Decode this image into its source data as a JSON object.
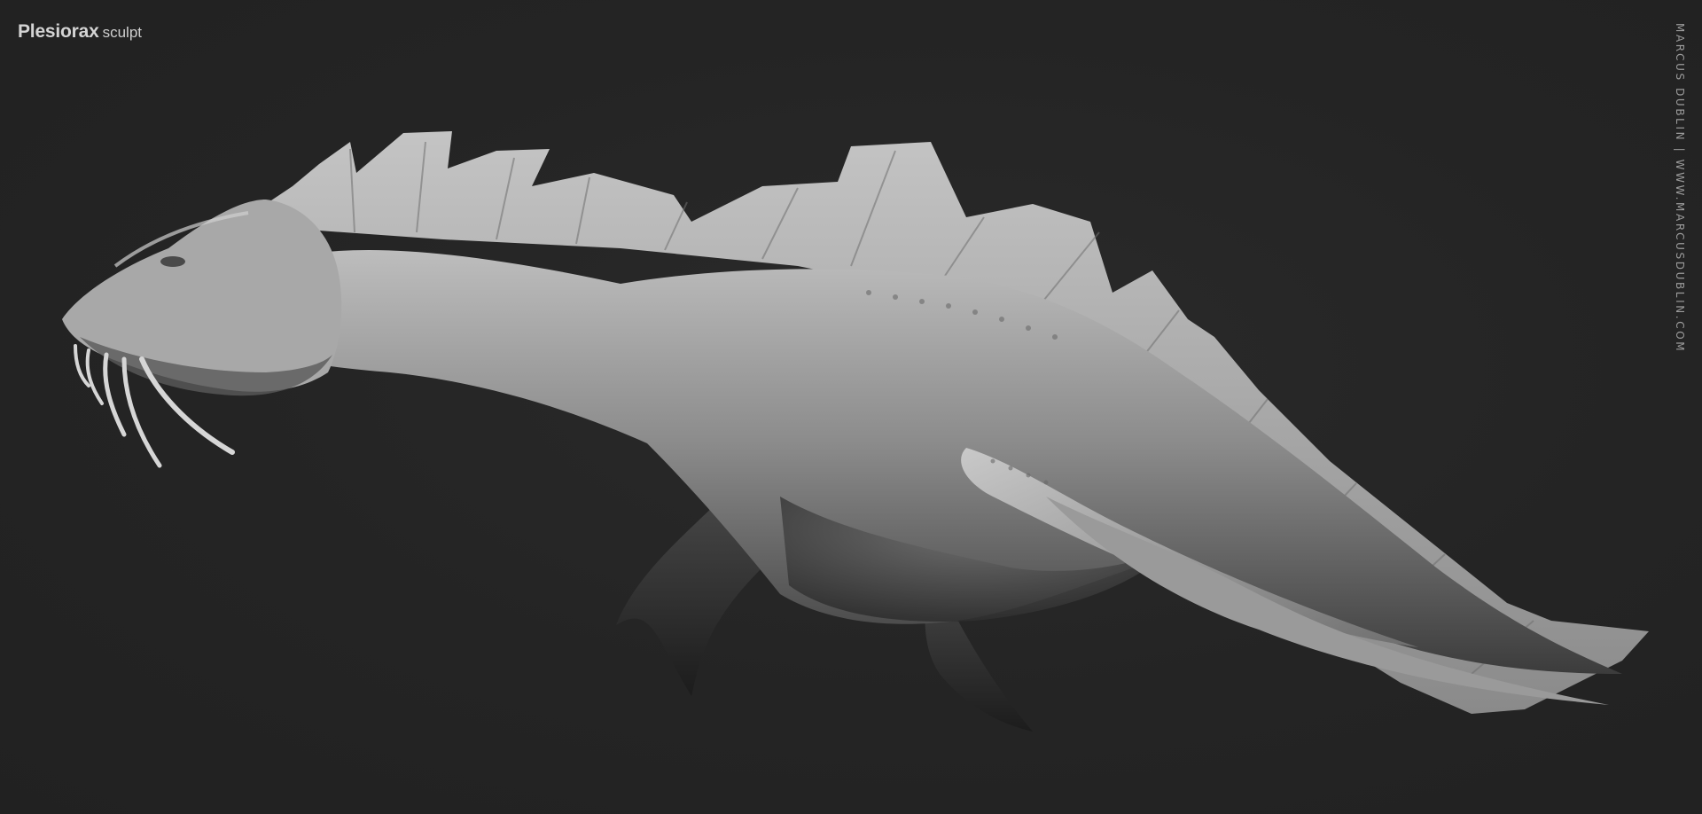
{
  "title": {
    "name": "Plesiorax",
    "subtitle": "sculpt"
  },
  "credit": "Marcus Dublin | www.marcusdublin.com",
  "image": {
    "subject": "Plesiorax",
    "colors": {
      "background": "#232323",
      "sculpt_light": "#b9b9b9",
      "sculpt_mid": "#7a7a7a",
      "sculpt_dark": "#3a3a3a"
    }
  }
}
